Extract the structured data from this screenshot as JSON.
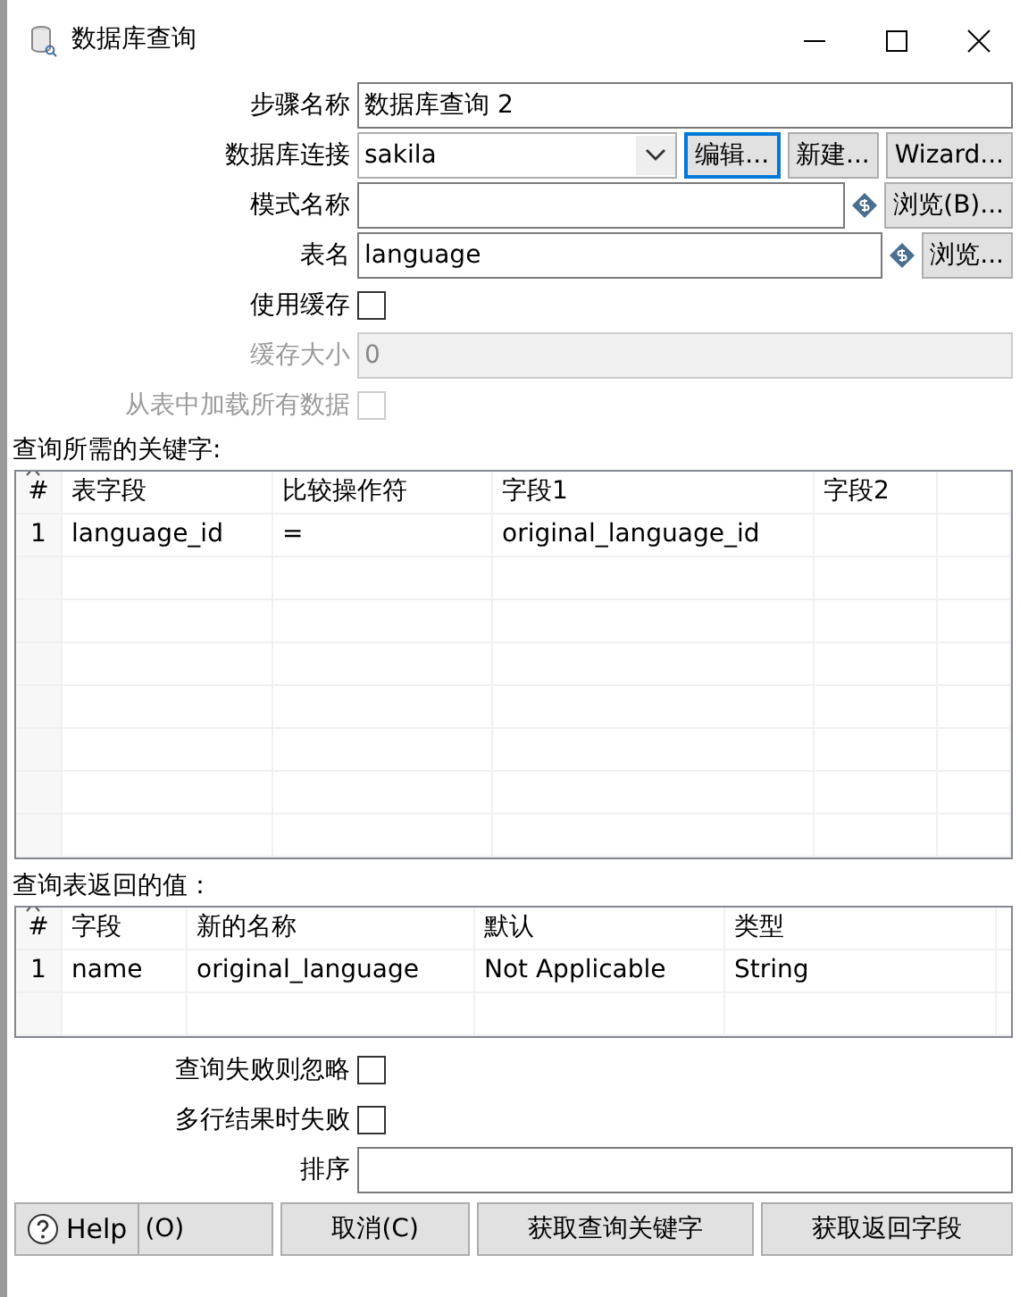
{
  "window": {
    "title": "数据库查询"
  },
  "form": [
    {
      "kind": "text",
      "label": "步骤名称",
      "value": "数据库查询 2",
      "disabled": false
    },
    {
      "kind": "select",
      "label": "数据库连接",
      "value": "sakila",
      "buttons": [
        {
          "label": "编辑...",
          "focused": true
        },
        {
          "label": "新建...",
          "focused": false
        },
        {
          "label": "Wizard...",
          "focused": false
        }
      ]
    },
    {
      "kind": "text",
      "label": "模式名称",
      "disabled": false,
      "variable_icon": true,
      "buttons": [
        {
          "label": "浏览(B)...",
          "focused": false
        }
      ]
    },
    {
      "kind": "text",
      "label": "表名",
      "value": "language",
      "disabled": false,
      "variable_icon": true,
      "buttons": [
        {
          "label": "浏览...",
          "focused": false
        }
      ]
    },
    {
      "kind": "checkbox",
      "label": "使用缓存",
      "checked": false,
      "disabled": false
    },
    {
      "kind": "text",
      "label": "缓存大小",
      "value": "0",
      "disabled": true
    },
    {
      "kind": "checkbox",
      "label": "从表中加载所有数据",
      "checked": false,
      "disabled": true
    }
  ],
  "keys_table": {
    "title": "查询所需的关键字:",
    "columns": [
      "#",
      "表字段",
      "比较操作符",
      "字段1",
      "字段2"
    ],
    "rows": [
      [
        "1",
        "language_id",
        "=",
        "original_language_id",
        ""
      ]
    ]
  },
  "return_table": {
    "title": "查询表返回的值：",
    "columns": [
      "#",
      "字段",
      "新的名称",
      "默认",
      "类型"
    ],
    "rows": [
      [
        "1",
        "name",
        "original_language",
        "Not Applicable",
        "String"
      ]
    ]
  },
  "options": [
    {
      "kind": "checkbox",
      "label": "查询失败则忽略",
      "checked": false,
      "disabled": false
    },
    {
      "kind": "checkbox",
      "label": "多行结果时失败",
      "checked": false,
      "disabled": false
    },
    {
      "kind": "text",
      "label": "排序",
      "disabled": false
    }
  ],
  "help_button": {
    "label": "Help"
  },
  "buttons": [
    "(O)",
    "取消(C)",
    "获取查询关键字",
    "获取返回字段"
  ]
}
